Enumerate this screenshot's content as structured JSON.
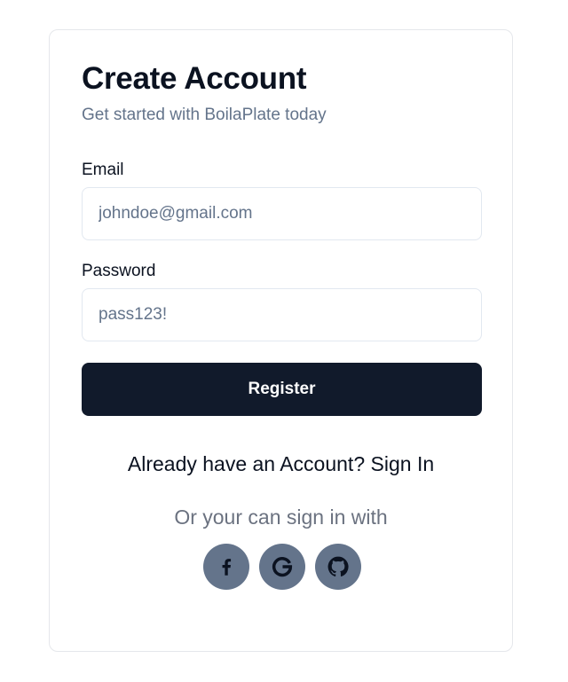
{
  "form": {
    "title": "Create Account",
    "subtitle": "Get started with BoilaPlate today",
    "email_label": "Email",
    "email_placeholder": "johndoe@gmail.com",
    "password_label": "Password",
    "password_placeholder": "pass123!",
    "register_label": "Register"
  },
  "signin": {
    "prompt": "Already have an Account?",
    "link": "Sign In"
  },
  "social": {
    "caption": "Or your can sign in with",
    "providers": [
      {
        "icon": "facebook-icon"
      },
      {
        "icon": "google-icon"
      },
      {
        "icon": "github-icon"
      }
    ]
  },
  "colors": {
    "primary": "#111a2b",
    "muted": "#64748b",
    "social_bg": "#64748b"
  }
}
